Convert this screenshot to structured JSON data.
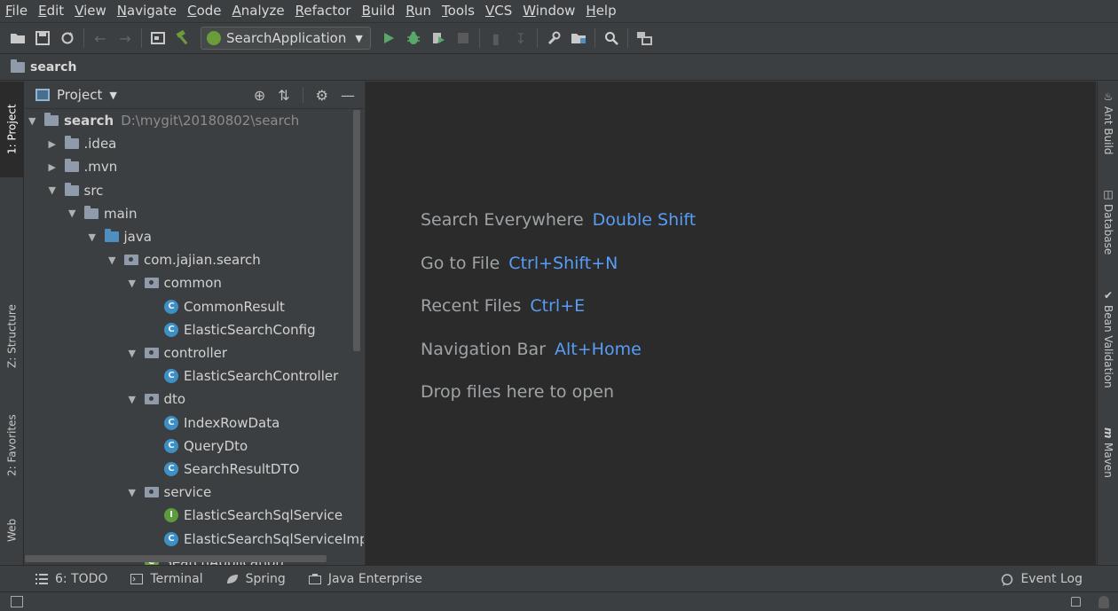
{
  "menu": [
    "File",
    "Edit",
    "View",
    "Navigate",
    "Code",
    "Analyze",
    "Refactor",
    "Build",
    "Run",
    "Tools",
    "VCS",
    "Window",
    "Help"
  ],
  "toolbar": {
    "run_config": "SearchApplication"
  },
  "navbar": {
    "crumb": "search"
  },
  "left_tabs": {
    "project": "1: Project",
    "structure": "Z: Structure",
    "favorites": "2: Favorites",
    "web": "Web"
  },
  "right_tabs": {
    "ant": "Ant Build",
    "database": "Database",
    "bean": "Bean Validation",
    "maven": "Maven"
  },
  "project_panel": {
    "title": "Project"
  },
  "tree": [
    {
      "label": "search",
      "path": "D:\\mygit\\20180802\\search",
      "icon": "folder-module-icon",
      "expanded": true
    },
    {
      "label": ".idea",
      "icon": "folder-icon",
      "expanded": false
    },
    {
      "label": ".mvn",
      "icon": "folder-icon",
      "expanded": false
    },
    {
      "label": "src",
      "icon": "folder-icon",
      "expanded": true
    },
    {
      "label": "main",
      "icon": "folder-icon",
      "expanded": true
    },
    {
      "label": "java",
      "icon": "source-folder-icon",
      "expanded": true
    },
    {
      "label": "com.jajian.search",
      "icon": "package-icon",
      "expanded": true
    },
    {
      "label": "common",
      "icon": "package-icon",
      "expanded": true
    },
    {
      "label": "CommonResult",
      "icon": "class-icon"
    },
    {
      "label": "ElasticSearchConfig",
      "icon": "class-icon"
    },
    {
      "label": "controller",
      "icon": "package-icon",
      "expanded": true
    },
    {
      "label": "ElasticSearchController",
      "icon": "class-icon"
    },
    {
      "label": "dto",
      "icon": "package-icon",
      "expanded": true
    },
    {
      "label": "IndexRowData",
      "icon": "class-icon"
    },
    {
      "label": "QueryDto",
      "icon": "class-icon"
    },
    {
      "label": "SearchResultDTO",
      "icon": "class-icon"
    },
    {
      "label": "service",
      "icon": "package-icon",
      "expanded": true
    },
    {
      "label": "ElasticSearchSqlService",
      "icon": "interface-icon"
    },
    {
      "label": "ElasticSearchSqlServiceImp",
      "icon": "class-icon"
    },
    {
      "label": "SearchApplication",
      "icon": "spring-boot-class-icon"
    }
  ],
  "editor_hints": [
    {
      "text": "Search Everywhere",
      "key": "Double Shift"
    },
    {
      "text": "Go to File",
      "key": "Ctrl+Shift+N"
    },
    {
      "text": "Recent Files",
      "key": "Ctrl+E"
    },
    {
      "text": "Navigation Bar",
      "key": "Alt+Home"
    },
    {
      "text": "Drop files here to open",
      "key": ""
    }
  ],
  "bottom_tabs": {
    "todo": "6: TODO",
    "terminal": "Terminal",
    "spring": "Spring",
    "java_enterprise": "Java Enterprise",
    "event_log": "Event Log"
  }
}
